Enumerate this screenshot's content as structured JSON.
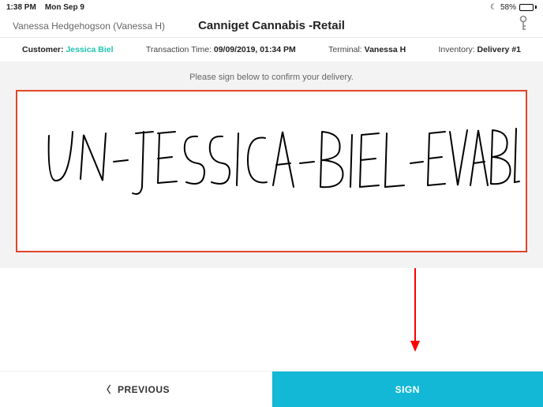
{
  "status_bar": {
    "time": "1:38 PM",
    "date": "Mon Sep 9",
    "moon_icon": "☾",
    "battery_percent": "58%"
  },
  "header": {
    "user_display": "Vanessa Hedgehogson (Vanessa H)",
    "title": "Canniget Cannabis -Retail"
  },
  "info": {
    "customer_label": "Customer:",
    "customer_value": "Jessica Biel",
    "transaction_label": "Transaction Time:",
    "transaction_value": "09/09/2019, 01:34 PM",
    "terminal_label": "Terminal:",
    "terminal_value": "Vanessa H",
    "inventory_label": "Inventory:",
    "inventory_value": "Delivery #1"
  },
  "instruction": "Please sign below to confirm your delivery.",
  "signature_text": "UN-JESSICA-BIEL-EVABLE",
  "buttons": {
    "previous": "PREVIOUS",
    "sign": "SIGN"
  },
  "colors": {
    "accent_teal": "#12b8d6",
    "accent_green": "#1fc4b0",
    "signature_border": "#e2452b",
    "arrow_red": "#ff0000"
  }
}
